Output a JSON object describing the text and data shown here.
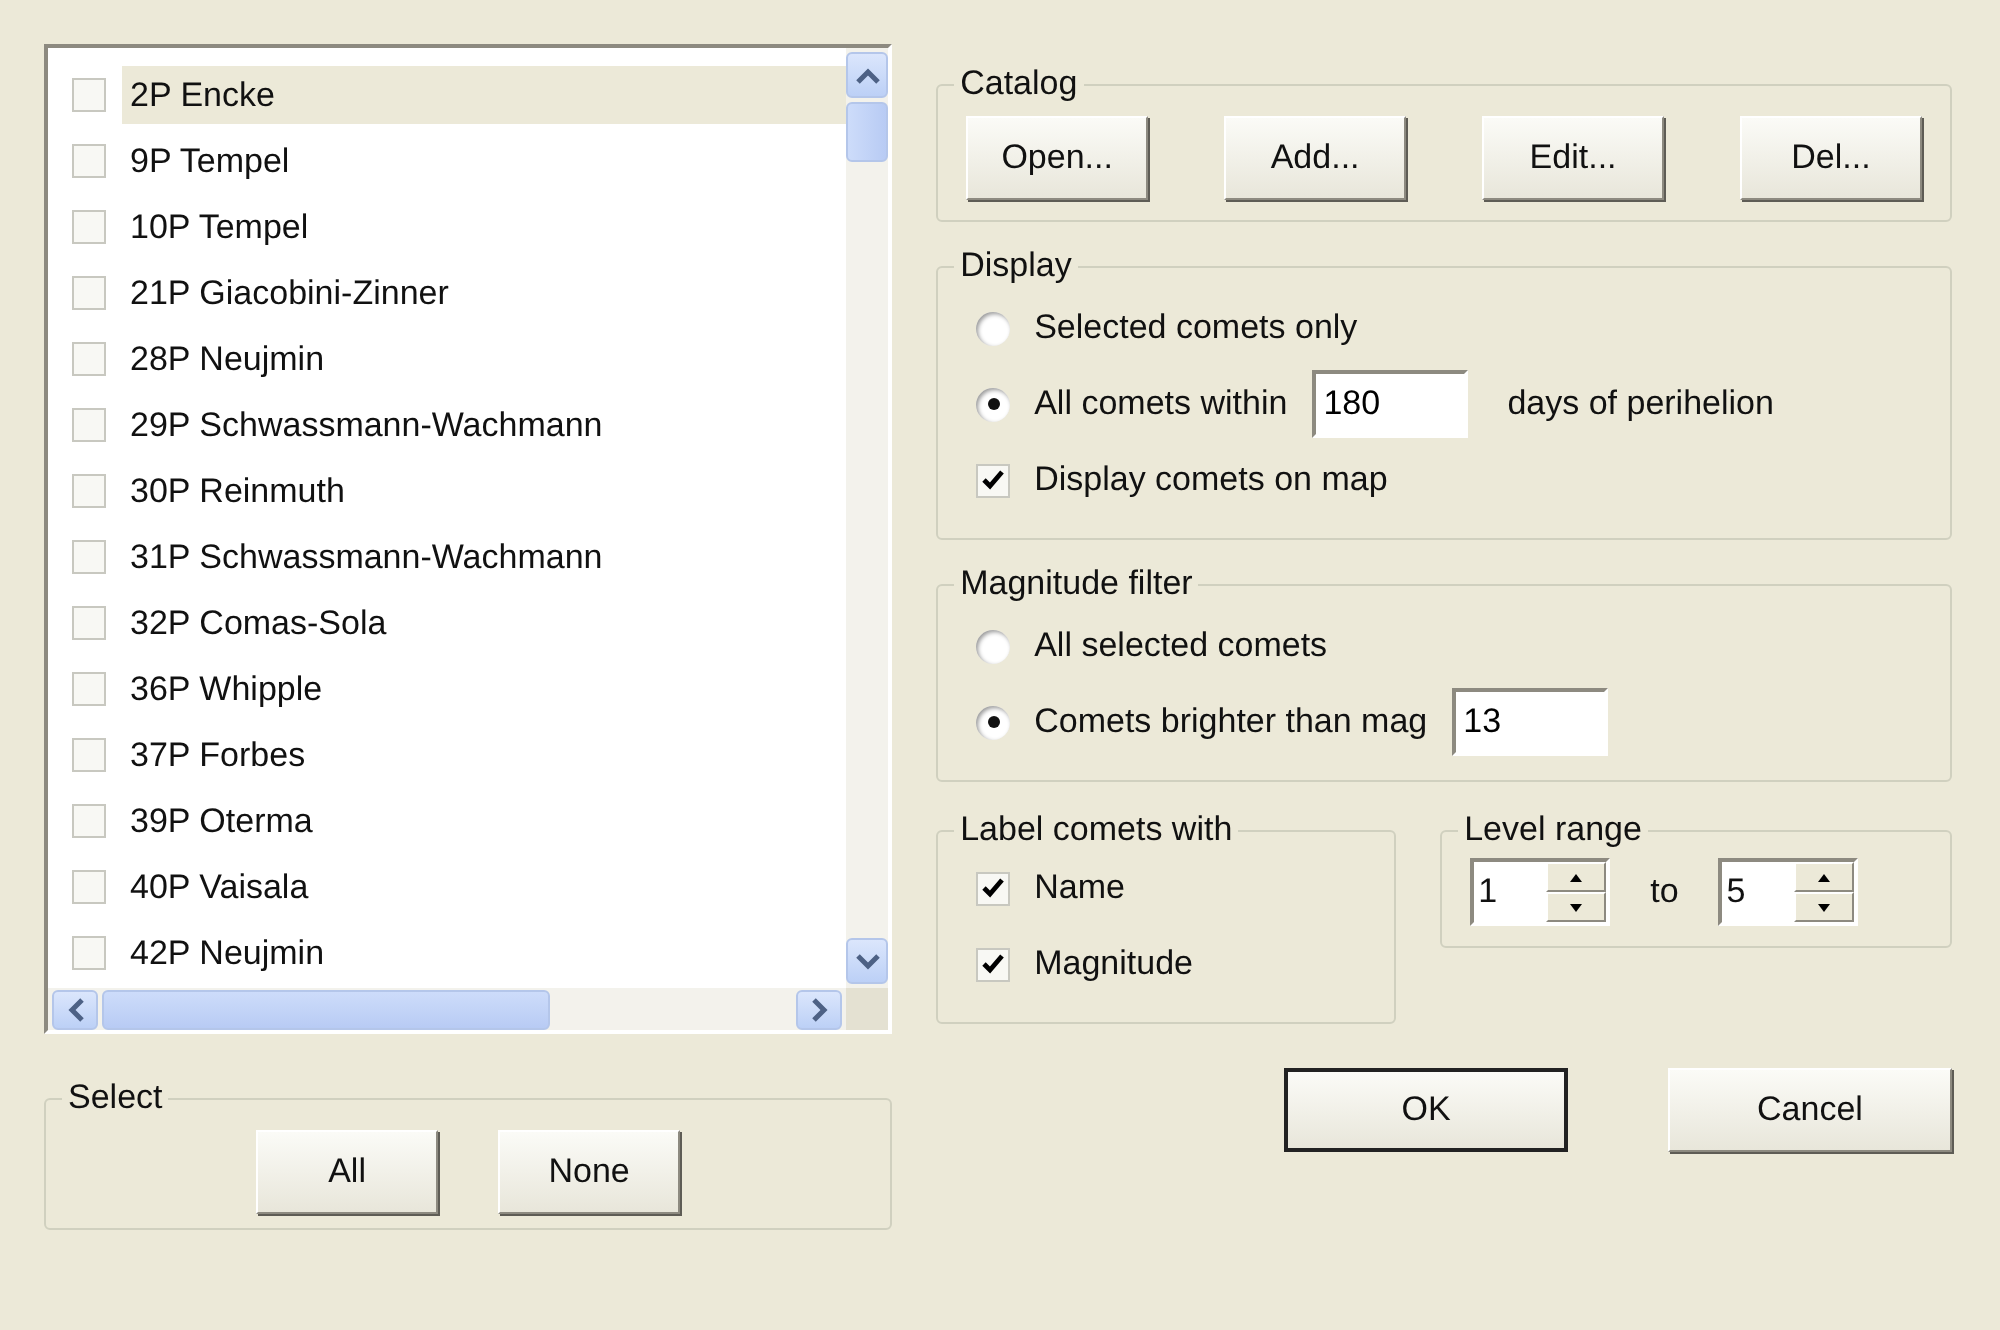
{
  "comet_list": {
    "items": [
      {
        "label": "2P Encke",
        "checked": false,
        "selected": true
      },
      {
        "label": "9P Tempel",
        "checked": false,
        "selected": false
      },
      {
        "label": "10P Tempel",
        "checked": false,
        "selected": false
      },
      {
        "label": "21P Giacobini-Zinner",
        "checked": false,
        "selected": false
      },
      {
        "label": "28P Neujmin",
        "checked": false,
        "selected": false
      },
      {
        "label": "29P Schwassmann-Wachmann",
        "checked": false,
        "selected": false
      },
      {
        "label": "30P Reinmuth",
        "checked": false,
        "selected": false
      },
      {
        "label": "31P Schwassmann-Wachmann",
        "checked": false,
        "selected": false
      },
      {
        "label": "32P Comas-Sola",
        "checked": false,
        "selected": false
      },
      {
        "label": "36P Whipple",
        "checked": false,
        "selected": false
      },
      {
        "label": "37P Forbes",
        "checked": false,
        "selected": false
      },
      {
        "label": "39P Oterma",
        "checked": false,
        "selected": false
      },
      {
        "label": "40P Vaisala",
        "checked": false,
        "selected": false
      },
      {
        "label": "42P Neujmin",
        "checked": false,
        "selected": false
      }
    ]
  },
  "select_group": {
    "title": "Select",
    "buttons": [
      "All",
      "None"
    ]
  },
  "catalog": {
    "title": "Catalog",
    "buttons": [
      "Open...",
      "Add...",
      "Edit...",
      "Del..."
    ]
  },
  "display": {
    "title": "Display",
    "options": [
      {
        "kind": "radio",
        "label": "Selected comets only",
        "selected": false
      },
      {
        "kind": "radio-field",
        "label": "All comets within",
        "value": "180",
        "suffix": "days of perihelion",
        "selected": true
      },
      {
        "kind": "checkbox",
        "label": "Display comets on map",
        "checked": true
      }
    ]
  },
  "magnitude_filter": {
    "title": "Magnitude filter",
    "options": [
      {
        "kind": "radio",
        "label": "All selected comets",
        "selected": false
      },
      {
        "kind": "radio-field",
        "label": "Comets brighter than mag",
        "value": "13",
        "selected": true
      }
    ]
  },
  "label_comets_with": {
    "title": "Label comets with",
    "options": [
      {
        "label": "Name",
        "checked": true
      },
      {
        "label": "Magnitude",
        "checked": true
      }
    ]
  },
  "level_range": {
    "title": "Level range",
    "from": "1",
    "separator": "to",
    "to": "5"
  },
  "dialog_buttons": [
    {
      "label": "OK",
      "default": true
    },
    {
      "label": "Cancel",
      "default": false
    }
  ]
}
